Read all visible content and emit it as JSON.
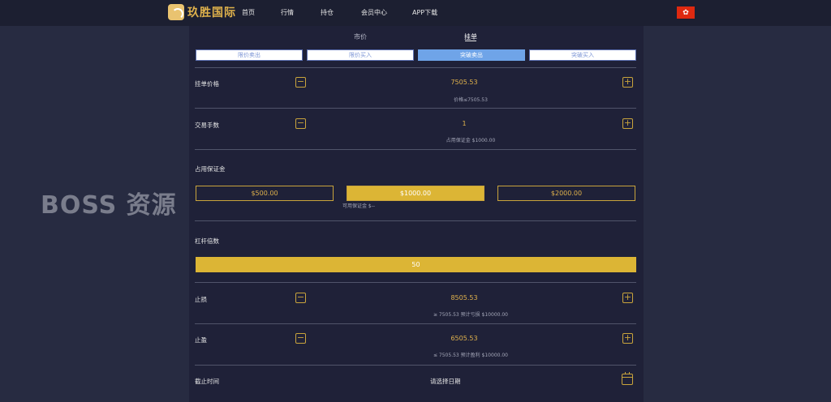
{
  "brand": {
    "name": "玖胜国际"
  },
  "nav": [
    "首页",
    "行情",
    "持仓",
    "会员中心",
    "APP下载"
  ],
  "watermark": "BOSS 资源",
  "tabs": [
    "市价",
    "挂单"
  ],
  "order_types": [
    "限价卖出",
    "限价买入",
    "突破卖出",
    "突破买入"
  ],
  "pending_price": {
    "label": "挂单价格",
    "value": "7505.53",
    "hint": "价格≤7505.53"
  },
  "trade_qty": {
    "label": "交易手数",
    "value": "1",
    "hint": "占用保证金 $1000.00"
  },
  "margin": {
    "label": "占用保证金",
    "options": [
      "$500.00",
      "$1000.00",
      "$2000.00"
    ],
    "available": "可用保证金 $--"
  },
  "leverage": {
    "label": "杠杆倍数",
    "value": "50"
  },
  "stop_loss": {
    "label": "止损",
    "value": "8505.53",
    "hint": "≥ 7505.53 预计亏损 $10000.00"
  },
  "take_profit": {
    "label": "止盈",
    "value": "6505.53",
    "hint": "≤ 7505.53 预计盈利 $10000.00"
  },
  "expiry": {
    "label": "截止时间",
    "placeholder": "请选择日期"
  },
  "icons": {
    "minus": "minus-icon",
    "plus": "plus-icon",
    "calendar": "calendar-icon",
    "flag": "hong-kong-flag-icon"
  },
  "colors": {
    "accent": "#dcb535",
    "tab_active": "#6fa4e8"
  }
}
